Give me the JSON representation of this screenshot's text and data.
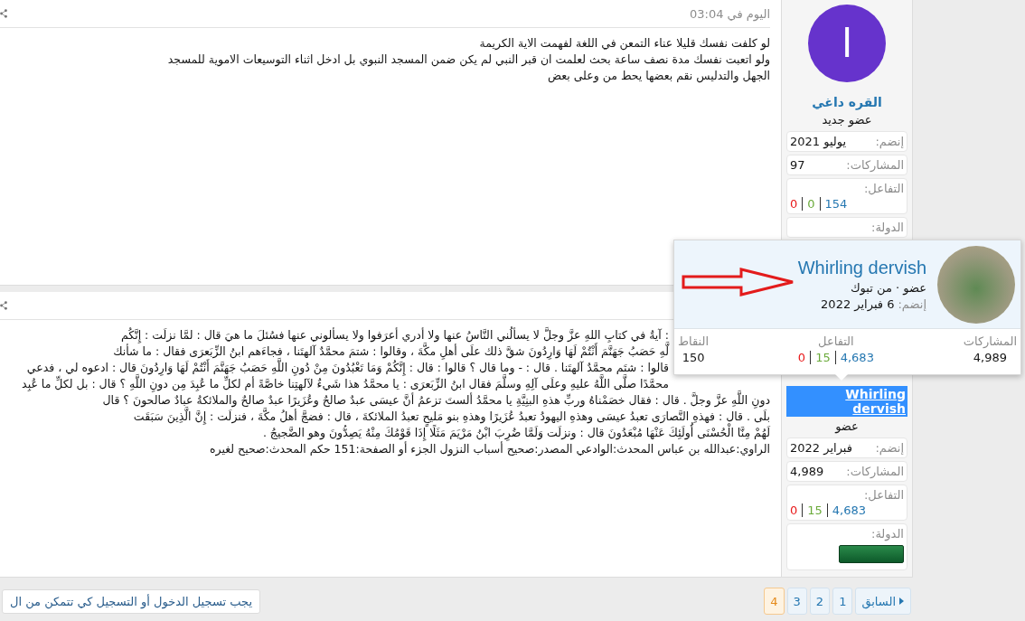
{
  "posts": [
    {
      "time": "اليوم في 03:04",
      "message": {
        "lines": [
          "لو كلفت نفسك قليلا عناء التمعن في اللغة لفهمت الاية الكريمة",
          "ولو اتعبت نفسك مدة نصف ساعة بحث لعلمت ان قبر النبي لم يكن ضمن المسجد النبوي بل ادخل اثناء التوسيعات الاموية للمسجد",
          "الجهل والتدليس نقم بعضها يحط من وعلى بعض"
        ]
      },
      "author": {
        "avatar": {
          "kind": "letter",
          "letter": "ا"
        },
        "name": "القره داغي",
        "selected": false,
        "title": "عضو جديد",
        "stats": [
          {
            "kind": "row",
            "label": "إنضم:",
            "value": "يوليو 2021"
          },
          {
            "kind": "row",
            "label": "المشاركات:",
            "value": "97"
          },
          {
            "kind": "reactions",
            "label": "التفاعل:",
            "values": [
              {
                "value": "154",
                "color": "#2577b1"
              },
              {
                "value": "0",
                "color": "#6aaa3a"
              },
              {
                "value": "0",
                "color": "#e8191a"
              }
            ]
          },
          {
            "kind": "label",
            "label": "الدولة:"
          }
        ]
      }
    },
    {
      "message": {
        "lines": [
          ": آيةٌ في كتابِ اللهِ عزَّ وجلَّ لا يسألُني النَّاسُ عنها ولا أدري أعرَفوا ولا يسألوني عنها فسُئلَ ما هيَ قال : لمَّا نزلَت : إِنَّكُم",
          "لَّهِ حَصَبُ جَهَنَّمَ أَنْتُمْ لَهَا وَارِدُونَ شقَّ ذلك علَى أهلِ مكَّةَ ، وقالوا : شتمَ محمَّدٌ آلهتَنا ، فجاءَهم ابنُ الزِّبَعرَى فقال : ما شأنك",
          "قالوا : شتَم محمَّدٌ آلهتَنا . قال : - وما قال ؟ قالوا : قال : إِنَّكُمْ وَمَا تَعْبُدُونَ مِنْ دُونِ اللَّهِ حَصَبُ جَهَنَّمَ أَنْتُمْ لَهَا وَارِدُونَ قال : ادعوه لي ، فدعي",
          "محمَّدًا صلَّى اللَّهُ عليهِ وعلَى آلِهِ وسلَّمَ فقال ابنُ الزِّبَعرَى : يا محمَّدُ هذا شَيءٌ لآلهتِنا خاصَّةً أم لكلِّ ما عُبِدَ مِن دونِ اللَّهِ ؟ قال : بل لكلِّ ما عُبِد",
          "دونِ اللَّهِ عزَّ وجلَّ . قال : فقال خصَمْناهُ وربِّ هذهِ البنِيَّةِ يا محمَّدُ ألستَ تزعمُ أنَّ عيسَى عبدٌ صالحٌ وعُزَيرًا عبدٌ صالحٌ والملائكةُ عبادٌ صالحونَ ؟ قال",
          "بلَى . قال : فهذهِ النَّصارَى تعبدُ عيسَى وهذهِ اليهودُ تعبدُ عُزَيرًا وهذهِ بنو مَليحٍ تعبدُ الملائكةَ ، قال : فضجَّ أهلُ مكَّةَ ، فنزلَت : إِنَّ الَّذِينَ سَبَقَت",
          "لَهُمْ مِنَّا الْحُسْنَى أُولَئِكَ عَنْهَا مُبْعَدُونَ قال : ونزلَت وَلَمَّا ضُرِبَ ابْنُ مَرْيَمَ مَثَلًا إِذَا قَوْمُكَ مِنْهُ يَصِدُّونَ وهو الضَّجيجُ .",
          "الراوي:عبدالله بن عباس المحدث:الوادعي المصدر:صحيح أسباب النزول الجزء أو الصفحة:151 حكم المحدث:صحيح لغيره"
        ]
      },
      "author": {
        "name": "Whirling dervish",
        "selected": true,
        "title": "عضو",
        "stats": [
          {
            "kind": "row",
            "label": "إنضم:",
            "value": "فبراير 2022"
          },
          {
            "kind": "row",
            "label": "المشاركات:",
            "value": "4,989"
          },
          {
            "kind": "reactions",
            "label": "التفاعل:",
            "values": [
              {
                "value": "4,683",
                "color": "#2577b1"
              },
              {
                "value": "15",
                "color": "#6aaa3a"
              },
              {
                "value": "0",
                "color": "#e8191a"
              }
            ]
          },
          {
            "kind": "flag",
            "label": "الدولة:"
          }
        ]
      }
    }
  ],
  "member_card": {
    "name": "Whirling dervish",
    "subtitle": "عضو · من تبوك",
    "joined_label": "إنضم:",
    "joined_value": "6 فبراير 2022",
    "stats": [
      {
        "kind": "text",
        "label": "المشاركات",
        "value": "4,989"
      },
      {
        "kind": "reactions",
        "label": "التفاعل",
        "values": [
          {
            "value": "4,683",
            "color": "#2577b1"
          },
          {
            "value": "15",
            "color": "#6aaa3a"
          },
          {
            "value": "0",
            "color": "#e8191a"
          }
        ]
      },
      {
        "kind": "text",
        "label": "النقاط",
        "value": "150"
      }
    ]
  },
  "pagination": {
    "previous": "السابق",
    "pages": [
      {
        "label": "1",
        "selected": false
      },
      {
        "label": "2",
        "selected": false
      },
      {
        "label": "3",
        "selected": false
      },
      {
        "label": "4",
        "selected": true
      }
    ]
  },
  "login_notice": "يجب تسجيل الدخول أو التسجيل كي تتمكن من ال"
}
